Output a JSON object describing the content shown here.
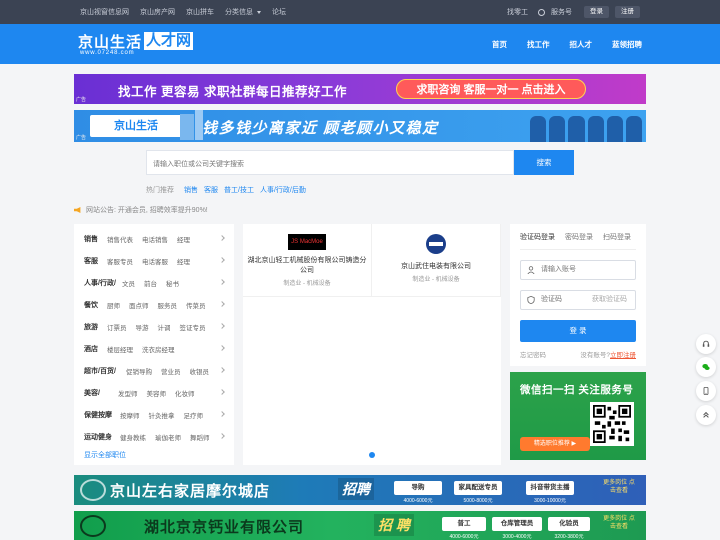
{
  "topbar": {
    "links": [
      "京山视窗信息网",
      "京山房产网",
      "京山拼车",
      "分类信息",
      "论坛"
    ],
    "right": {
      "find_worker": "找零工",
      "service": "服务号",
      "login": "登录",
      "register": "注册"
    }
  },
  "logo": {
    "text_a": "京山生活",
    "text_b": "人才网",
    "url": "www.07248.com"
  },
  "nav": [
    "首页",
    "找工作",
    "招人才",
    "蓝领招聘"
  ],
  "banner1": {
    "text": "找工作 更容易 求职社群每日推荐好工作",
    "button": "求职咨询 客服一对一 点击进入",
    "ad": "广告"
  },
  "banner2": {
    "logo": "京山生活",
    "text": "钱多钱少离家近 顾老顾小又稳定",
    "ad": "广告"
  },
  "search": {
    "placeholder": "请输入职位或公司关键字搜索",
    "button": "搜索"
  },
  "hot": {
    "label": "热门推荐",
    "items": [
      "销售",
      "客服",
      "普工/技工",
      "人事/行政/后勤"
    ]
  },
  "notice": "网站公告: 开通会员, 招聘效率提升90%!",
  "categories": [
    {
      "head": "销售",
      "subs": [
        "销售代表",
        "电话销售",
        "经理"
      ]
    },
    {
      "head": "客服",
      "subs": [
        "客服专员",
        "电话客服",
        "经理"
      ]
    },
    {
      "head": "人事/行政/",
      "subs": [
        "文员",
        "前台",
        "秘书"
      ]
    },
    {
      "head": "餐饮",
      "subs": [
        "厨师",
        "面点师",
        "服务员",
        "传菜员"
      ]
    },
    {
      "head": "旅游",
      "subs": [
        "订票员",
        "导游",
        "计调",
        "签证专员"
      ]
    },
    {
      "head": "酒店",
      "subs": [
        "楼层经理",
        "洗衣房经理"
      ]
    },
    {
      "head": "超市/百货/",
      "subs": [
        "促销导购",
        "营业员",
        "收银员"
      ]
    },
    {
      "head": "美容/",
      "subs": [
        "发型师",
        "美容师",
        "化妆师"
      ]
    },
    {
      "head": "保健按摩",
      "subs": [
        "按摩师",
        "针灸推拿",
        "足疗师"
      ]
    },
    {
      "head": "运动健身",
      "subs": [
        "健身教练",
        "瑜伽老师",
        "舞蹈师"
      ]
    }
  ],
  "show_all": "显示全部职位",
  "companies": [
    {
      "logo": "JS MacMoe",
      "name": "湖北京山轻工机械股份有限公司铸造分公司",
      "industry": "制造业 - 机械设备"
    },
    {
      "name": "京山武住电装有限公司",
      "industry": "制造业 - 机械设备"
    }
  ],
  "login": {
    "tabs": [
      "验证码登录",
      "密码登录",
      "扫码登录"
    ],
    "account_placeholder": "请输入账号",
    "code_placeholder": "验证码",
    "get_code": "获取验证码",
    "button": "登 录",
    "forgot": "忘记密码",
    "no_account": "没有账号?",
    "register": "立即注册"
  },
  "wechat": {
    "title": "微信扫一扫 关注服务号",
    "button": "精选职位推荐 ▶"
  },
  "ad3": {
    "title": "京山左右家居摩尔城店",
    "hire": "招聘",
    "jobs": [
      {
        "name": "导购",
        "salary": "4000-6000元"
      },
      {
        "name": "家具配送专员",
        "salary": "5000-8000元"
      },
      {
        "name": "抖音带货主播",
        "salary": "3000-10000元"
      }
    ],
    "more": "更多岗位 点击查看"
  },
  "ad4": {
    "title": "湖北京京钙业有限公司",
    "hire": "招 聘",
    "jobs": [
      {
        "name": "普工",
        "salary": "4000-6000元"
      },
      {
        "name": "仓库管理员",
        "salary": "3000-4000元"
      },
      {
        "name": "化验员",
        "salary": "3200-3800元"
      }
    ],
    "more": "更多岗位 点击查看"
  },
  "colors": {
    "primary": "#1e87f0",
    "topbar": "#3b4353",
    "wechat": "#1f9a47"
  }
}
